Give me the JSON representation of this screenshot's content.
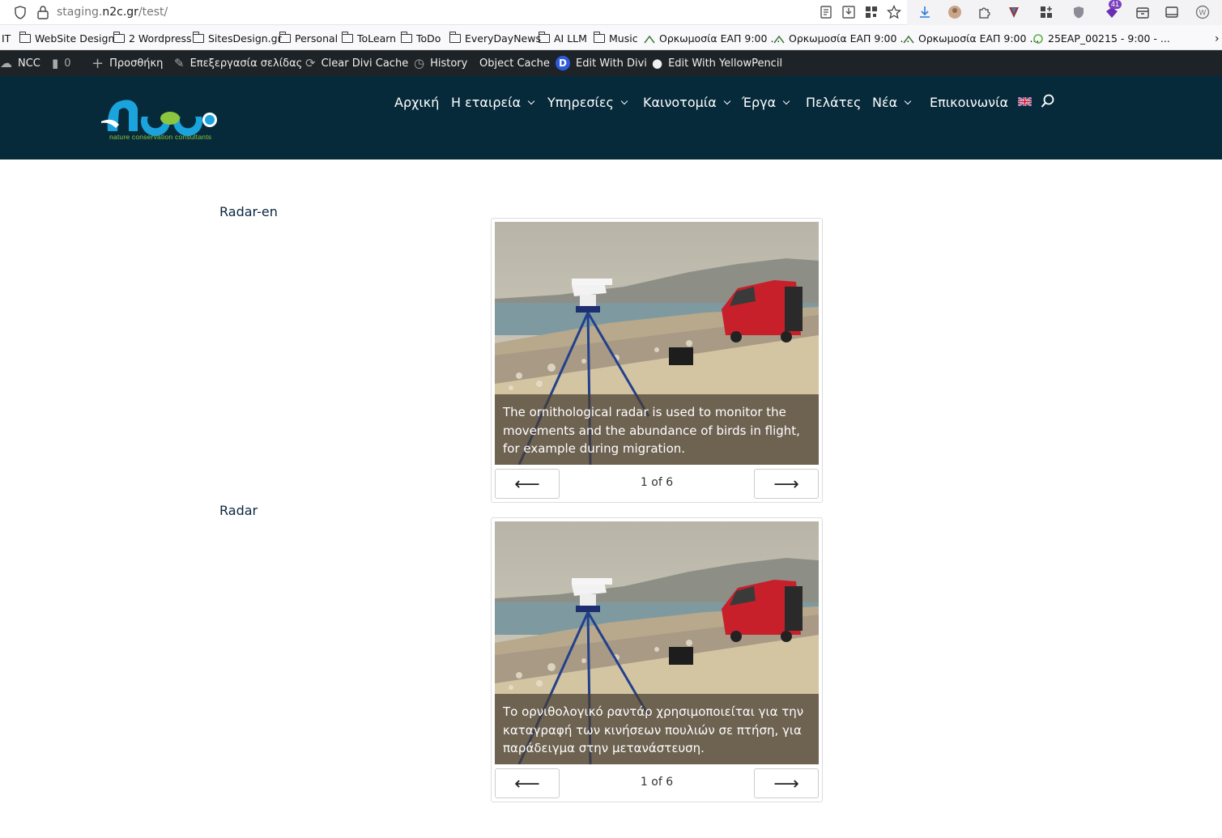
{
  "browser": {
    "url_host": "staging.",
    "url_domain": "n2c.gr",
    "url_path": "/test/",
    "extension_badge": "41"
  },
  "bookmarks": [
    {
      "label": "IT",
      "type": "text"
    },
    {
      "label": "WebSite Design",
      "type": "folder"
    },
    {
      "label": "2 Wordpress",
      "type": "folder"
    },
    {
      "label": "SitesDesign.gr",
      "type": "folder"
    },
    {
      "label": "Personal",
      "type": "folder"
    },
    {
      "label": "ToLearn",
      "type": "folder"
    },
    {
      "label": "ToDo",
      "type": "folder"
    },
    {
      "label": "EveryDayNews",
      "type": "folder"
    },
    {
      "label": "AI LLM",
      "type": "folder"
    },
    {
      "label": "Music",
      "type": "folder"
    },
    {
      "label": "Ορκωμοσία ΕΑΠ 9:00 ...",
      "type": "link"
    },
    {
      "label": "Ορκωμοσία ΕΑΠ 9:00 ...",
      "type": "link"
    },
    {
      "label": "Ορκωμοσία ΕΑΠ 9:00 ...",
      "type": "link"
    },
    {
      "label": "25EAP_00215 - 9:00 - ...",
      "type": "link"
    }
  ],
  "adminbar": {
    "site": "NCC",
    "comments": "0",
    "add_new": "Προσθήκη",
    "edit_page": "Επεξεργασία σελίδας",
    "clear_cache": "Clear Divi Cache",
    "history": "History",
    "object_cache": "Object Cache",
    "edit_divi": "Edit With Divi",
    "edit_yellow": "Edit With YellowPencil"
  },
  "header": {
    "logo_text": "nature conservation consultants",
    "nav": [
      "Αρχική",
      "Η εταιρεία",
      "Υπηρεσίες",
      "Καινοτομία",
      "Έργα",
      "Πελάτες",
      "Νέα",
      "Επικοινωνία"
    ]
  },
  "sections": [
    {
      "label": "Radar-en",
      "caption": "The ornithological radar is used to monitor the movements and the abundance of birds in flight, for example during migration.",
      "counter": "1 of 6",
      "prev": "⟵",
      "next": "⟶"
    },
    {
      "label": "Radar",
      "caption": "Το ορνιθολογικό ραντάρ χρησιμοποιείται για την καταγραφή των κινήσεων πουλιών σε πτήση, για παράδειγμα στην μετανάστευση.",
      "counter": "1 of 6",
      "prev": "⟵",
      "next": "⟶"
    }
  ],
  "colors": {
    "header_bg": "#062a3a",
    "adminbar_bg": "#1d2327",
    "van_red": "#c8202a"
  }
}
